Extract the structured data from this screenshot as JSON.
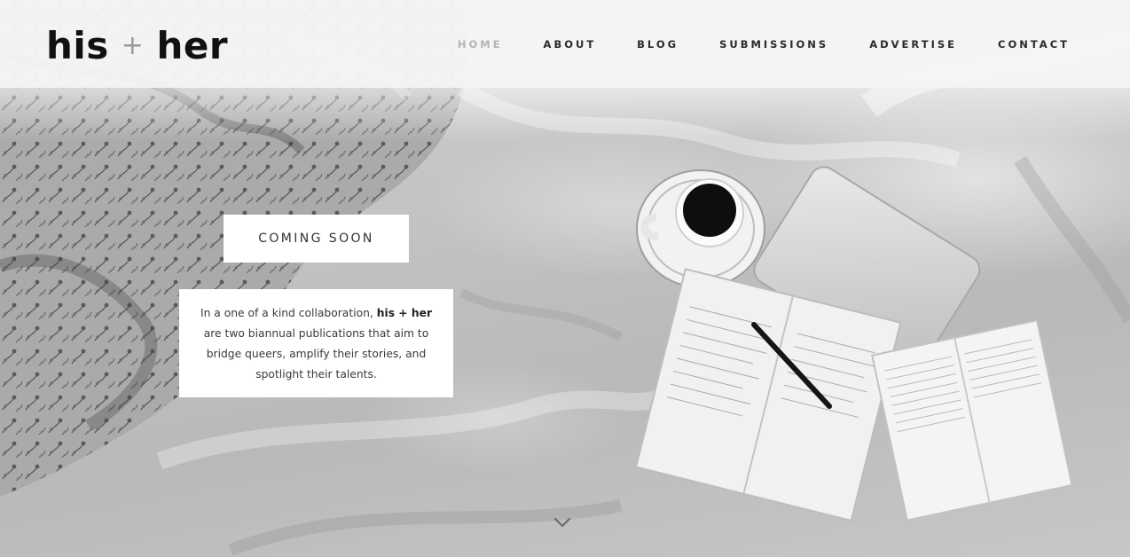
{
  "site": {
    "logo": {
      "part1": "his",
      "plus": "+",
      "part2": "her"
    }
  },
  "nav": {
    "items": [
      {
        "label": "HOME",
        "active": true
      },
      {
        "label": "ABOUT",
        "active": false
      },
      {
        "label": "BLOG",
        "active": false
      },
      {
        "label": "SUBMISSIONS",
        "active": false
      },
      {
        "label": "ADVERTISE",
        "active": false
      },
      {
        "label": "CONTACT",
        "active": false
      }
    ]
  },
  "hero": {
    "badge": "COMING SOON",
    "intro": {
      "before": "In a one of a kind collaboration, ",
      "bold": "his + her",
      "after": " are two biannual publications that aim to bridge queers, amplify their stories, and spotlight their talents."
    },
    "scroll_icon": "chevron-down-icon"
  },
  "colors": {
    "header_bg": "#f6f6f6",
    "nav_text": "#2a2a2a",
    "nav_active": "#b4b4b4",
    "card_bg": "#ffffff"
  }
}
